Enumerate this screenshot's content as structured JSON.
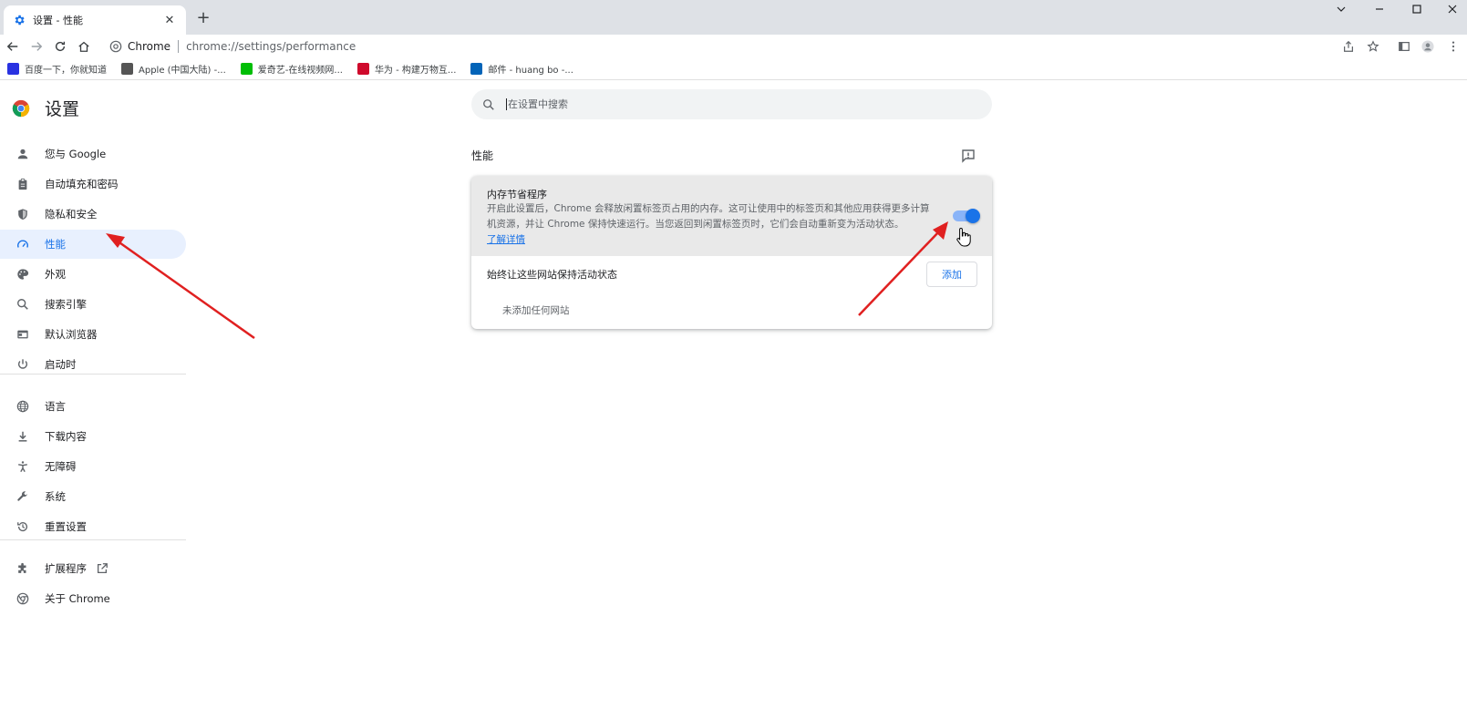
{
  "browser": {
    "tab_title": "设置 - 性能",
    "tab_close": "✕",
    "new_tab": "+",
    "omnibox_chip": "Chrome",
    "omnibox_url": "chrome://settings/performance"
  },
  "bookmarks": [
    {
      "label": "百度一下，你就知道",
      "icon_color": "#2932e1"
    },
    {
      "label": "Apple (中国大陆) -...",
      "icon_color": "#555555"
    },
    {
      "label": "爱奇艺-在线视频网...",
      "icon_color": "#00be06"
    },
    {
      "label": "华为 - 构建万物互...",
      "icon_color": "#cf0a2c"
    },
    {
      "label": "邮件 - huang bo -...",
      "icon_color": "#0364b8"
    }
  ],
  "sidebar": {
    "title": "设置",
    "items": [
      {
        "label": "您与 Google",
        "icon": "person-icon"
      },
      {
        "label": "自动填充和密码",
        "icon": "clipboard-icon"
      },
      {
        "label": "隐私和安全",
        "icon": "shield-icon"
      },
      {
        "label": "性能",
        "icon": "speedometer-icon",
        "active": true
      },
      {
        "label": "外观",
        "icon": "palette-icon"
      },
      {
        "label": "搜索引擎",
        "icon": "search-icon"
      },
      {
        "label": "默认浏览器",
        "icon": "browser-icon"
      },
      {
        "label": "启动时",
        "icon": "power-icon"
      },
      {
        "label": "语言",
        "icon": "globe-icon"
      },
      {
        "label": "下载内容",
        "icon": "download-icon"
      },
      {
        "label": "无障碍",
        "icon": "accessibility-icon"
      },
      {
        "label": "系统",
        "icon": "wrench-icon"
      },
      {
        "label": "重置设置",
        "icon": "history-icon"
      },
      {
        "label": "扩展程序",
        "icon": "puzzle-icon"
      },
      {
        "label": "关于 Chrome",
        "icon": "chrome-icon"
      }
    ]
  },
  "search": {
    "placeholder": "在设置中搜索"
  },
  "section": {
    "title": "性能"
  },
  "memory_saver": {
    "title": "内存节省程序",
    "description": "开启此设置后，Chrome 会释放闲置标签页占用的内存。这可让使用中的标签页和其他应用获得更多计算机资源，并让 Chrome 保持快速运行。当您返回到闲置标签页时，它们会自动重新变为活动状态。",
    "learn_more": "了解详情",
    "enabled": true
  },
  "keep_active": {
    "label": "始终让这些网站保持活动状态",
    "add_button": "添加",
    "empty_text": "未添加任何网站"
  },
  "colors": {
    "accent": "#1a73e8",
    "annotation_arrow": "#e02020"
  }
}
